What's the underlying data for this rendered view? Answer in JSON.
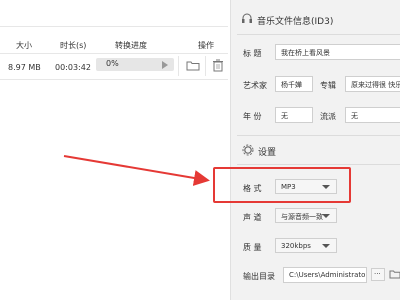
{
  "file_table": {
    "headers": [
      "大小",
      "时长(s)",
      "转换进度",
      "操作"
    ],
    "row": {
      "size": "8.97 MB",
      "duration": "00:03:42",
      "progress": "0%",
      "progress_fraction": 0
    }
  },
  "id3": {
    "section_title": "音乐文件信息(ID3)",
    "title_label": "标 题",
    "title_value": "我在桥上看风景",
    "artist_label": "艺术家",
    "artist_value": "杨千嬅",
    "album_label": "专辑",
    "album_value": "原来过得很 快乐",
    "year_label": "年 份",
    "year_value": "无",
    "genre_label": "流派",
    "genre_value": "无"
  },
  "settings": {
    "section_title": "设置",
    "format_label": "格 式",
    "format_value": "MP3",
    "channel_label": "声 道",
    "channel_value": "与源音频一致",
    "quality_label": "质 量",
    "quality_value": "320kbps",
    "output_label": "输出目录",
    "output_path": "C:\\Users\\Administrator",
    "browse_label": "···"
  },
  "colors": {
    "highlight_box": "#e53935",
    "arrow": "#e53935"
  }
}
